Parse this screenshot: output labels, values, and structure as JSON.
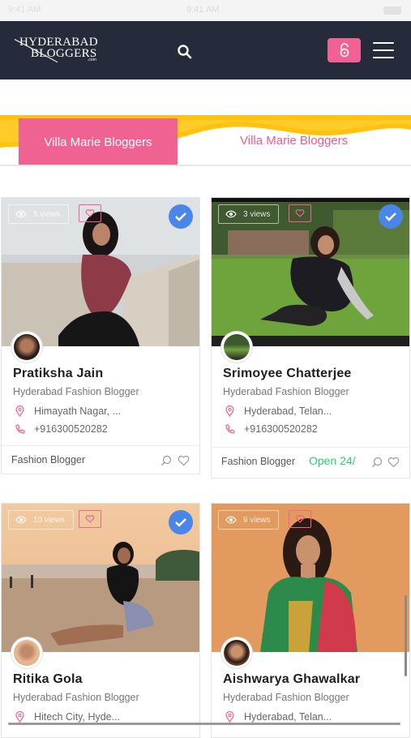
{
  "statusbar": {
    "left": "9:41 AM",
    "time": "9:41 AM"
  },
  "header": {
    "logo_line1": "HYDERABAD",
    "logo_line2": "BLOGGERS",
    "logo_suffix": ".com",
    "icons": [
      "search-icon",
      "unlock-icon",
      "hamburger-menu-icon"
    ],
    "accent_color": "#f06292",
    "bar_color": "#252b3a"
  },
  "tabs": [
    {
      "label": "Villa Marie Bloggers",
      "active": true
    },
    {
      "label": "Villa Marie Bloggers",
      "active": false
    }
  ],
  "profiles": [
    {
      "views": "5 views",
      "name": "Pratiksha Jain",
      "subtitle": "Hyderabad Fashion Blogger",
      "location": "Himayath Nagar, ...",
      "phone": "+916300520282",
      "category": "Fashion Blogger",
      "open": "",
      "verified": true
    },
    {
      "views": "3 views",
      "name": "Srimoyee Chatterjee",
      "subtitle": "Hyderabad Fashion Blogger",
      "location": "Hyderabad, Telan...",
      "phone": "+916300520282",
      "category": "Fashion Blogger",
      "open": "Open 24/",
      "verified": true
    },
    {
      "views": "10 views",
      "name": "Ritika Gola",
      "subtitle": "Hyderabad Fashion Blogger",
      "location": "Hitech City, Hyde...",
      "phone": "",
      "category": "",
      "open": "",
      "verified": true
    },
    {
      "views": "9 views",
      "name": "Aishwarya Ghawalkar",
      "subtitle": "Hyderabad Fashion Blogger",
      "location": "Hyderabad, Telan...",
      "phone": "",
      "category": "",
      "open": "",
      "verified": false
    }
  ],
  "colors": {
    "open_status": "#2ecc71",
    "verified": "#4a86e8"
  }
}
